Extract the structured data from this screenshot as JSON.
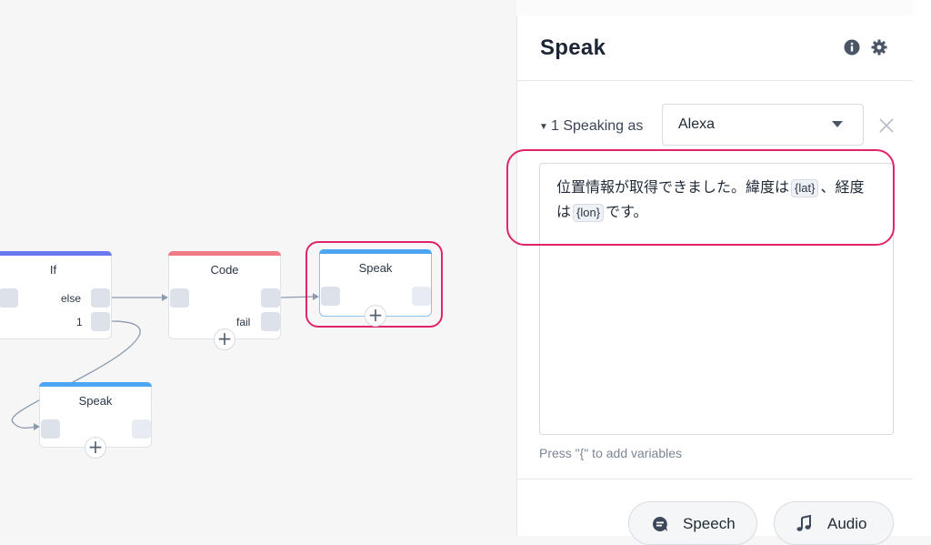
{
  "canvas": {
    "nodes": {
      "if": {
        "title": "If",
        "ports": {
          "else": "else",
          "one": "1"
        }
      },
      "code": {
        "title": "Code",
        "ports": {
          "fail": "fail"
        }
      },
      "speak_selected": {
        "title": "Speak"
      },
      "speak_lower": {
        "title": "Speak"
      }
    },
    "add_symbol": "+",
    "colors": {
      "if_bar": "#6a79f0",
      "code_bar": "#ef7b86",
      "speak_bar": "#4da6f3",
      "highlight": "#e0246a"
    }
  },
  "panel": {
    "title": "Speak",
    "icons": {
      "info": "info-icon",
      "settings": "gear-icon"
    },
    "speaking": {
      "index_label": "1 Speaking as",
      "voice": "Alexa",
      "remove_icon": "close-icon"
    },
    "text": {
      "part1": "位置情報が取得できました。緯度は",
      "var1": "{lat}",
      "part2": "、経度は",
      "var2": "{lon}",
      "part3": "です。"
    },
    "hint": "Press \"{\" to add variables",
    "buttons": {
      "speech": "Speech",
      "audio": "Audio"
    }
  }
}
